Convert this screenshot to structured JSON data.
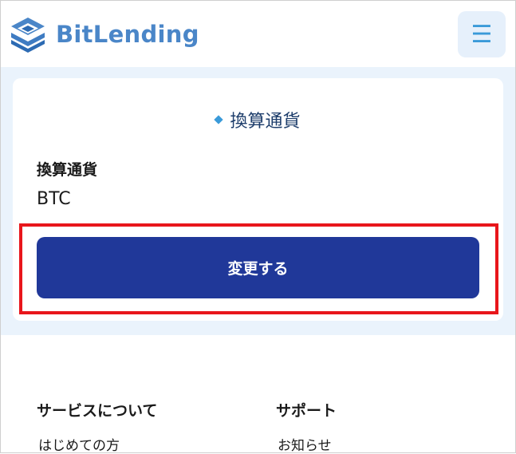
{
  "header": {
    "logo_text": "BitLending",
    "menu_icon": "hamburger-icon"
  },
  "card": {
    "title": "換算通貨",
    "field_label": "換算通貨",
    "field_value": "BTC",
    "button_label": "変更する"
  },
  "footer": {
    "col1_heading": "サービスについて",
    "col1_link": "はじめての方",
    "col2_heading": "サポート",
    "col2_link": "お知らせ"
  },
  "colors": {
    "brand": "#4a86c8",
    "button": "#203899",
    "highlight": "#e8161b",
    "band": "#eaf3fc"
  }
}
